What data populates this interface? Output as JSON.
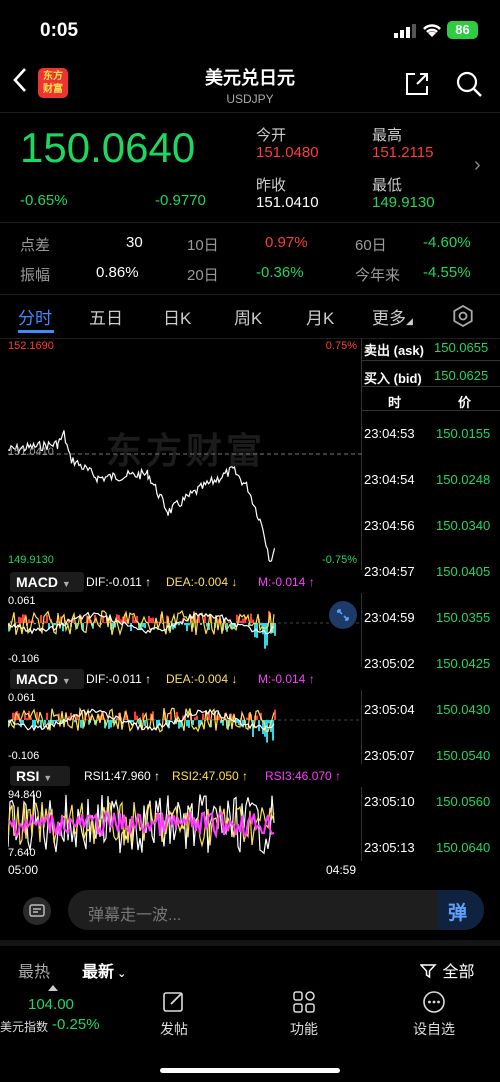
{
  "status": {
    "time": "0:05",
    "battery": "86"
  },
  "nav": {
    "title": "美元兑日元",
    "subtitle": "USDJPY",
    "logo_line1": "东方",
    "logo_line2": "财富"
  },
  "quote": {
    "price": "150.0640",
    "pct": "-0.65%",
    "change": "-0.9770",
    "open_label": "今开",
    "open": "151.0480",
    "high_label": "最高",
    "high": "151.2115",
    "prev_label": "昨收",
    "prev": "151.0410",
    "low_label": "最低",
    "low": "149.9130"
  },
  "stats": {
    "spread_label": "点差",
    "spread": "30",
    "d10_label": "10日",
    "d10": "0.97%",
    "d60_label": "60日",
    "d60": "-4.60%",
    "amp_label": "振幅",
    "amp": "0.86%",
    "d20_label": "20日",
    "d20": "-0.36%",
    "ytd_label": "今年来",
    "ytd": "-4.55%"
  },
  "tabs": [
    "分时",
    "五日",
    "日K",
    "周K",
    "月K",
    "更多"
  ],
  "chart": {
    "top_left": "152.1690",
    "top_right": "0.75%",
    "bottom_left": "149.9130",
    "bottom_right": "-0.75%",
    "mid_left": "151.0410",
    "watermark": "东方财富",
    "time_start": "05:00",
    "time_end": "04:59"
  },
  "macd1": {
    "label": "MACD",
    "dif": "DIF:-0.011 ↑",
    "dea": "DEA:-0.004 ↓",
    "m": "M:-0.014 ↑",
    "top": "0.061",
    "bottom": "-0.106"
  },
  "macd2": {
    "label": "MACD",
    "dif": "DIF:-0.011 ↑",
    "dea": "DEA:-0.004 ↓",
    "m": "M:-0.014 ↑",
    "top": "0.061",
    "bottom": "-0.106"
  },
  "rsi": {
    "label": "RSI",
    "rsi1": "RSI1:47.960 ↑",
    "rsi2": "RSI2:47.050 ↑",
    "rsi3": "RSI3:46.070 ↑",
    "top": "94.840",
    "bottom": "7.640"
  },
  "orderbook": {
    "ask_label": "卖出 (ask)",
    "ask": "150.0655",
    "bid_label": "买入 (bid)",
    "bid": "150.0625",
    "col_time": "时",
    "col_price": "价",
    "ticks": [
      {
        "t": "23:04:53",
        "p": "150.0155"
      },
      {
        "t": "23:04:54",
        "p": "150.0248"
      },
      {
        "t": "23:04:56",
        "p": "150.0340"
      },
      {
        "t": "23:04:57",
        "p": "150.0405"
      },
      {
        "t": "23:04:59",
        "p": "150.0355"
      },
      {
        "t": "23:05:02",
        "p": "150.0425"
      },
      {
        "t": "23:05:04",
        "p": "150.0430"
      },
      {
        "t": "23:05:07",
        "p": "150.0540"
      },
      {
        "t": "23:05:10",
        "p": "150.0560"
      },
      {
        "t": "23:05:13",
        "p": "150.0640"
      }
    ]
  },
  "comment": {
    "placeholder": "弹幕走一波...",
    "danmu": "弹"
  },
  "feed": {
    "hot": "最热",
    "latest": "最新",
    "filter": "全部"
  },
  "footer": {
    "index_value": "104.00",
    "index_name": "美元指数",
    "index_pct": "-0.25%",
    "post": "发帖",
    "func": "功能",
    "watch": "设自选"
  },
  "colors": {
    "up": "#ff3b3b",
    "down": "#1ed760",
    "accent": "#3c8cff",
    "dea": "#ffe14a",
    "m": "#ff3bff"
  }
}
